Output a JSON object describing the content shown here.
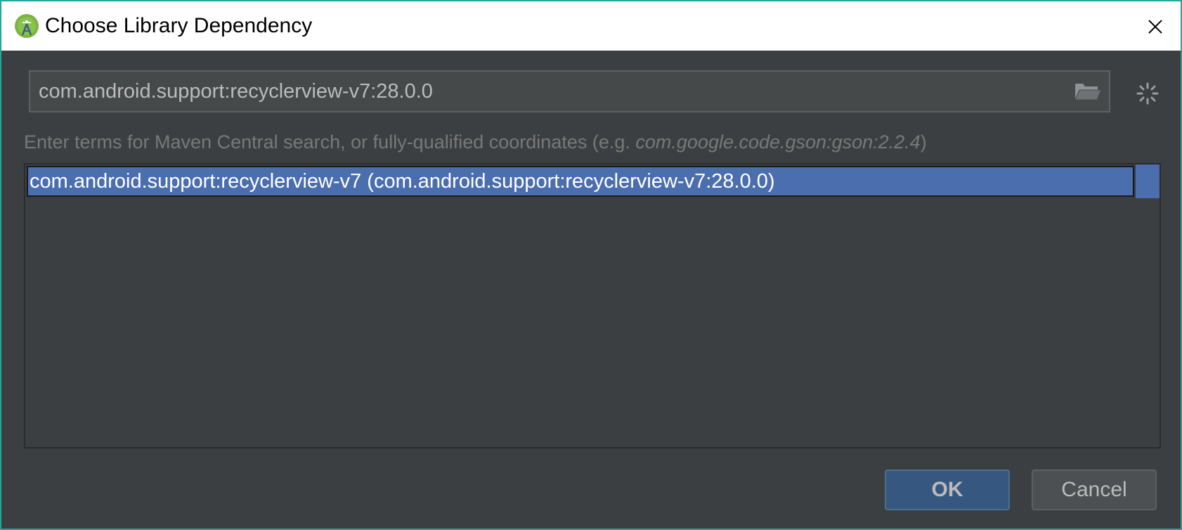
{
  "window": {
    "title": "Choose Library Dependency",
    "accent_color": "#1fa99a"
  },
  "search": {
    "value": "com.android.support:recyclerview-v7:28.0.0"
  },
  "hint": {
    "prefix": "Enter terms for Maven Central search, or fully-qualified coordinates (e.g. ",
    "example": "com.google.code.gson:gson:2.2.4",
    "suffix": ")"
  },
  "results": {
    "items": [
      {
        "label": "com.android.support:recyclerview-v7 (com.android.support:recyclerview-v7:28.0.0)",
        "selected": true
      }
    ],
    "selection_color": "#4b6eaf"
  },
  "buttons": {
    "ok_label": "OK",
    "cancel_label": "Cancel"
  },
  "icons": {
    "app": "android-studio-icon",
    "close": "close-icon",
    "browse": "folder-open-icon",
    "loading": "spinner-icon"
  }
}
